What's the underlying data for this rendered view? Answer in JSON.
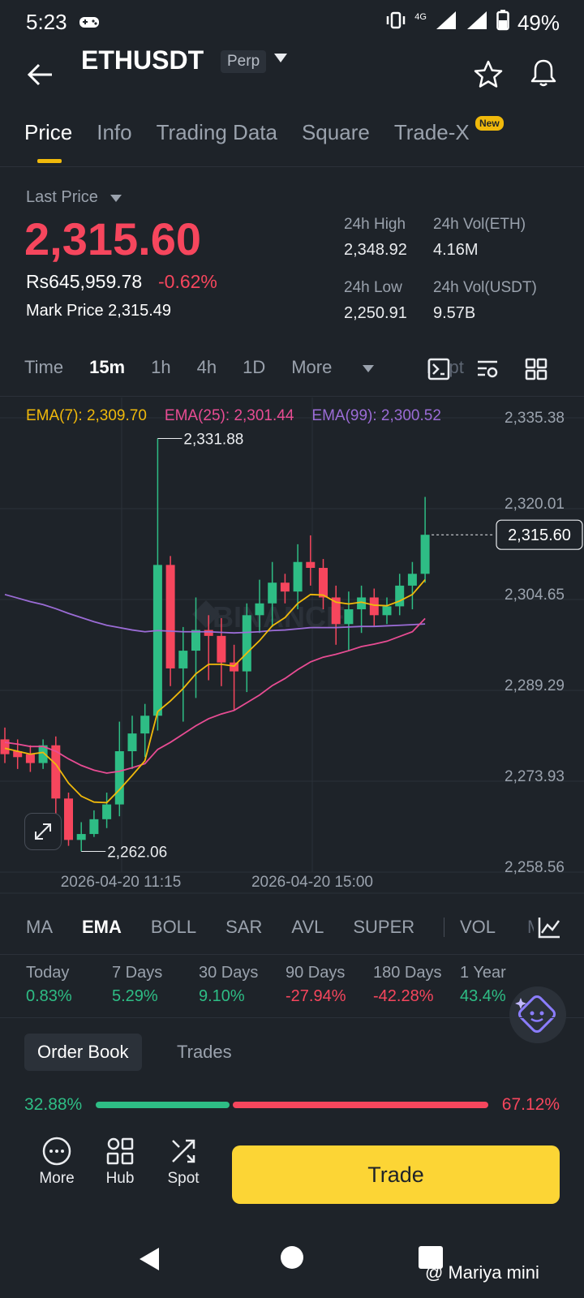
{
  "status": {
    "time": "5:23",
    "battery": "49%",
    "network": "4G"
  },
  "header": {
    "symbol": "ETHUSDT",
    "badge": "Perp"
  },
  "tabs": [
    {
      "label": "Price"
    },
    {
      "label": "Info"
    },
    {
      "label": "Trading Data"
    },
    {
      "label": "Square"
    },
    {
      "label": "Trade-X"
    }
  ],
  "tab_badge": "New",
  "price_panel": {
    "last_price_label": "Last Price",
    "last_price": "2,315.60",
    "inr_price": "Rs645,959.78",
    "change_pct": "-0.62%",
    "mark_price_label": "Mark Price",
    "mark_price": "2,315.49",
    "high_label": "24h High",
    "high": "2,348.92",
    "vol_eth_label": "24h Vol(ETH)",
    "vol_eth": "4.16M",
    "low_label": "24h Low",
    "low": "2,250.91",
    "vol_usdt_label": "24h Vol(USDT)",
    "vol_usdt": "9.57B"
  },
  "intervals": [
    "Time",
    "15m",
    "1h",
    "4h",
    "1D",
    "More",
    "Dept"
  ],
  "ema_legend": {
    "ema7": "EMA(7): 2,309.70",
    "ema25": "EMA(25): 2,301.44",
    "ema99": "EMA(99): 2,300.52"
  },
  "chart_data": {
    "type": "candlestick",
    "y_ticks": [
      "2,335.38",
      "2,320.01",
      "2,304.65",
      "2,289.29",
      "2,273.93",
      "2,258.56"
    ],
    "ylim": [
      2258.56,
      2335.38
    ],
    "x_labels": [
      "2026-04-20 11:15",
      "2026-04-20 15:00"
    ],
    "current_price_label": "2,315.60",
    "current_price": 2315.6,
    "high_marker": "2,331.88",
    "high_marker_value": 2331.88,
    "low_marker": "2,262.06",
    "low_marker_value": 2262.06,
    "watermark": "BINANCE",
    "candles": [
      [
        2281.0,
        2278.5,
        2283.0,
        2277.0
      ],
      [
        2279.0,
        2278.0,
        2281.0,
        2276.0
      ],
      [
        2278.5,
        2277.0,
        2280.0,
        2275.5
      ],
      [
        2277.0,
        2280.0,
        2281.0,
        2276.0
      ],
      [
        2280.0,
        2271.0,
        2281.5,
        2267.0
      ],
      [
        2271.0,
        2264.0,
        2272.0,
        2263.0
      ],
      [
        2264.0,
        2265.0,
        2267.0,
        2262.06
      ],
      [
        2265.0,
        2267.5,
        2269.0,
        2264.5
      ],
      [
        2267.5,
        2270.0,
        2272.0,
        2266.0
      ],
      [
        2270.0,
        2279.0,
        2284.0,
        2268.0
      ],
      [
        2279.0,
        2282.0,
        2285.0,
        2276.0
      ],
      [
        2282.0,
        2285.0,
        2287.0,
        2278.0
      ],
      [
        2285.0,
        2310.5,
        2331.88,
        2282.5
      ],
      [
        2310.5,
        2293.0,
        2312.0,
        2290.0
      ],
      [
        2293.0,
        2296.0,
        2300.0,
        2284.0
      ],
      [
        2296.0,
        2299.5,
        2305.0,
        2288.0
      ],
      [
        2299.5,
        2298.5,
        2302.0,
        2291.0
      ],
      [
        2298.5,
        2294.0,
        2301.5,
        2290.0
      ],
      [
        2294.0,
        2292.5,
        2297.0,
        2286.0
      ],
      [
        2292.5,
        2302.0,
        2304.0,
        2289.0
      ],
      [
        2302.0,
        2304.0,
        2308.0,
        2299.0
      ],
      [
        2304.0,
        2307.5,
        2311.0,
        2300.0
      ],
      [
        2307.5,
        2306.0,
        2309.0,
        2304.0
      ],
      [
        2306.0,
        2311.0,
        2314.0,
        2303.0
      ],
      [
        2311.0,
        2310.0,
        2315.5,
        2307.0
      ],
      [
        2310.0,
        2305.0,
        2311.5,
        2303.0
      ],
      [
        2305.0,
        2300.5,
        2307.0,
        2297.0
      ],
      [
        2300.5,
        2303.0,
        2306.0,
        2296.0
      ],
      [
        2303.0,
        2305.0,
        2307.0,
        2299.0
      ],
      [
        2305.0,
        2302.0,
        2306.5,
        2300.0
      ],
      [
        2302.0,
        2303.5,
        2305.0,
        2300.5
      ],
      [
        2303.5,
        2307.0,
        2309.0,
        2302.0
      ],
      [
        2307.0,
        2309.0,
        2311.0,
        2303.0
      ],
      [
        2309.0,
        2315.6,
        2322.0,
        2307.5
      ]
    ],
    "ema7": [
      2279.5,
      2279.0,
      2278.5,
      2278.8,
      2276.8,
      2273.6,
      2271.4,
      2270.4,
      2270.3,
      2272.5,
      2274.9,
      2277.4,
      2285.7,
      2287.5,
      2289.6,
      2292.1,
      2293.7,
      2293.7,
      2293.4,
      2295.6,
      2297.7,
      2300.2,
      2301.6,
      2304.0,
      2305.5,
      2305.4,
      2304.2,
      2303.9,
      2304.2,
      2303.7,
      2303.6,
      2304.4,
      2305.5,
      2308.0
    ],
    "ema25": [
      2280.5,
      2280.2,
      2279.8,
      2279.8,
      2279.0,
      2277.7,
      2276.6,
      2275.8,
      2275.3,
      2275.6,
      2276.2,
      2276.9,
      2279.3,
      2280.5,
      2281.9,
      2283.3,
      2284.5,
      2285.3,
      2285.9,
      2287.2,
      2288.5,
      2290.1,
      2291.3,
      2292.8,
      2294.1,
      2294.9,
      2295.4,
      2296.0,
      2296.7,
      2297.1,
      2297.6,
      2298.4,
      2299.2,
      2301.44
    ],
    "ema99": [
      2305.5,
      2304.9,
      2304.3,
      2303.8,
      2303.1,
      2302.3,
      2301.6,
      2300.9,
      2300.3,
      2299.9,
      2299.5,
      2299.2,
      2299.4,
      2299.3,
      2299.2,
      2299.2,
      2299.2,
      2299.1,
      2299.0,
      2299.1,
      2299.2,
      2299.4,
      2299.5,
      2299.7,
      2299.9,
      2299.9,
      2299.9,
      2300.0,
      2300.1,
      2300.1,
      2300.2,
      2300.3,
      2300.4,
      2300.52
    ]
  },
  "indicators": [
    "MA",
    "EMA",
    "BOLL",
    "SAR",
    "AVL",
    "SUPER",
    "VOL",
    "M"
  ],
  "performance": [
    {
      "label": "Today",
      "value": "0.83%",
      "up": true
    },
    {
      "label": "7 Days",
      "value": "5.29%",
      "up": true
    },
    {
      "label": "30 Days",
      "value": "9.10%",
      "up": true
    },
    {
      "label": "90 Days",
      "value": "-27.94%",
      "up": false
    },
    {
      "label": "180 Days",
      "value": "-42.28%",
      "up": false
    },
    {
      "label": "1 Year",
      "value": "43.4%",
      "up": true
    }
  ],
  "orderbook": {
    "tab_orderbook": "Order Book",
    "tab_trades": "Trades",
    "bid_pct": "32.88%",
    "ask_pct": "67.12%"
  },
  "bottom_bar": {
    "more": "More",
    "hub": "Hub",
    "spot": "Spot",
    "trade": "Trade"
  },
  "watermark_text": "@ Mariya mini",
  "colors": {
    "up": "#2ebd85",
    "down": "#f6465d",
    "ema7": "#f0b90b",
    "ema25": "#e84c93",
    "ema99": "#9b6cd6",
    "accent": "#fcd535"
  }
}
